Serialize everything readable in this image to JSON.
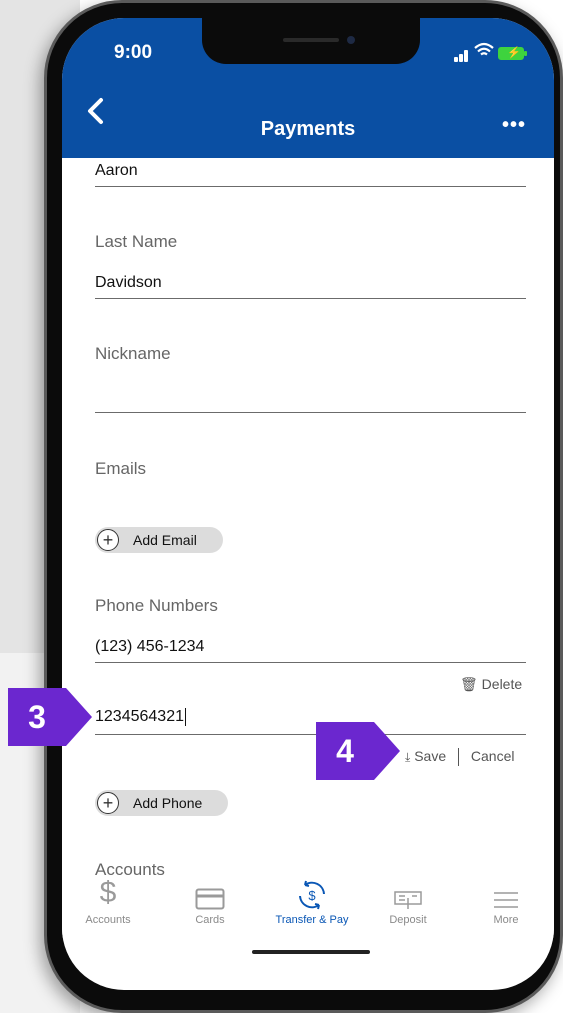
{
  "status_bar": {
    "time": "9:00"
  },
  "header": {
    "title": "Payments",
    "more_label": "•••"
  },
  "form": {
    "first_name_value": "Aaron",
    "last_name_label": "Last Name",
    "last_name_value": "Davidson",
    "nickname_label": "Nickname",
    "nickname_value": "",
    "emails_label": "Emails",
    "add_email_label": "Add Email",
    "phone_numbers_label": "Phone Numbers",
    "phone_1_value": "(123) 456-1234",
    "delete_label": "Delete",
    "phone_2_value": "1234564321",
    "save_label": "Save",
    "cancel_label": "Cancel",
    "add_phone_label": "Add Phone",
    "accounts_label": "Accounts"
  },
  "tabbar": {
    "items": [
      {
        "label": "Accounts",
        "icon": "dollar-icon"
      },
      {
        "label": "Cards",
        "icon": "card-icon"
      },
      {
        "label": "Transfer & Pay",
        "icon": "transfer-pay-icon",
        "active": true
      },
      {
        "label": "Deposit",
        "icon": "deposit-icon"
      },
      {
        "label": "More",
        "icon": "menu-icon"
      }
    ]
  },
  "annotations": {
    "step_3": "3",
    "step_4": "4"
  },
  "colors": {
    "header": "#0a4fa3",
    "active_tab": "#0a57b5",
    "annotation": "#6b27cf"
  }
}
